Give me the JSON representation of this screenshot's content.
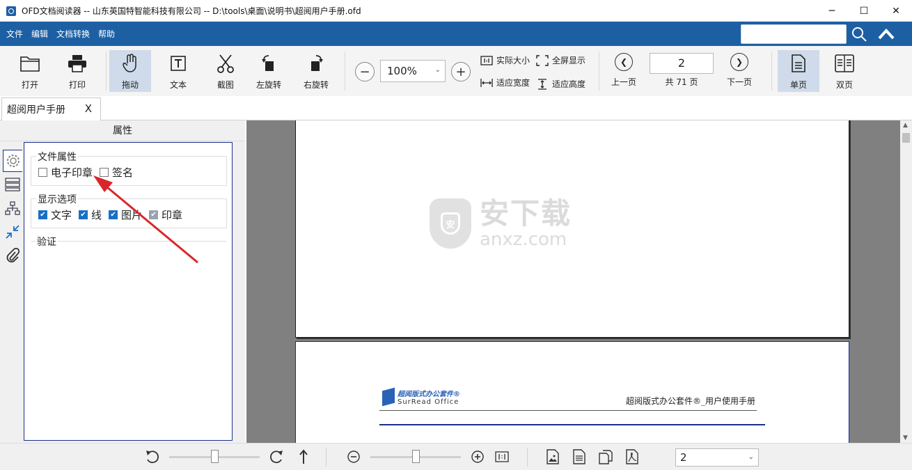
{
  "window": {
    "title": "OFD文档阅读器 -- 山东英国特智能科技有限公司   --   D:\\tools\\桌面\\说明书\\超阅用户手册.ofd",
    "minimize": "─",
    "maximize": "☐",
    "close": "✕"
  },
  "menu": [
    "文件",
    "编辑",
    "文档转换",
    "帮助"
  ],
  "search": {
    "placeholder": "",
    "value": ""
  },
  "toolbar": {
    "open": "打开",
    "print": "打印",
    "drag": "拖动",
    "text": "文本",
    "screenshot": "截图",
    "rotate_left": "左旋转",
    "rotate_right": "右旋转",
    "zoom_value": "100%",
    "actual_size": "实际大小",
    "fullscreen": "全屏显示",
    "fit_width": "适应宽度",
    "fit_height": "适应高度",
    "prev_page": "上一页",
    "page_number": "2",
    "total_pages": "共 71 页",
    "next_page": "下一页",
    "single_page": "单页",
    "double_page": "双页"
  },
  "tab": {
    "label": "超阅用户手册",
    "close": "X"
  },
  "panel": {
    "header": "属性",
    "file_props": {
      "title": "文件属性",
      "items": [
        {
          "label": "电子印章",
          "checked": false
        },
        {
          "label": "签名",
          "checked": false
        }
      ]
    },
    "display_opts": {
      "title": "显示选项",
      "items": [
        {
          "label": "文字",
          "checked": true
        },
        {
          "label": "线",
          "checked": true
        },
        {
          "label": "图片",
          "checked": true
        },
        {
          "label": "印章",
          "checked": true,
          "disabled": true
        }
      ]
    },
    "verify": {
      "title": "验证"
    }
  },
  "document": {
    "logo_cn": "超阅版式办公套件®",
    "logo_en": "SurRead Office",
    "header_right": "超阅版式办公套件®_用户使用手册",
    "watermark_cn": "安下载",
    "watermark_en": "anxz.com",
    "watermark_badge": "安"
  },
  "bottom": {
    "page_select": "2"
  },
  "colors": {
    "menubar": "#1d5fa3",
    "accent_border": "#1a2f8a",
    "arrow": "#d9262a",
    "doc_bg": "#808080"
  }
}
